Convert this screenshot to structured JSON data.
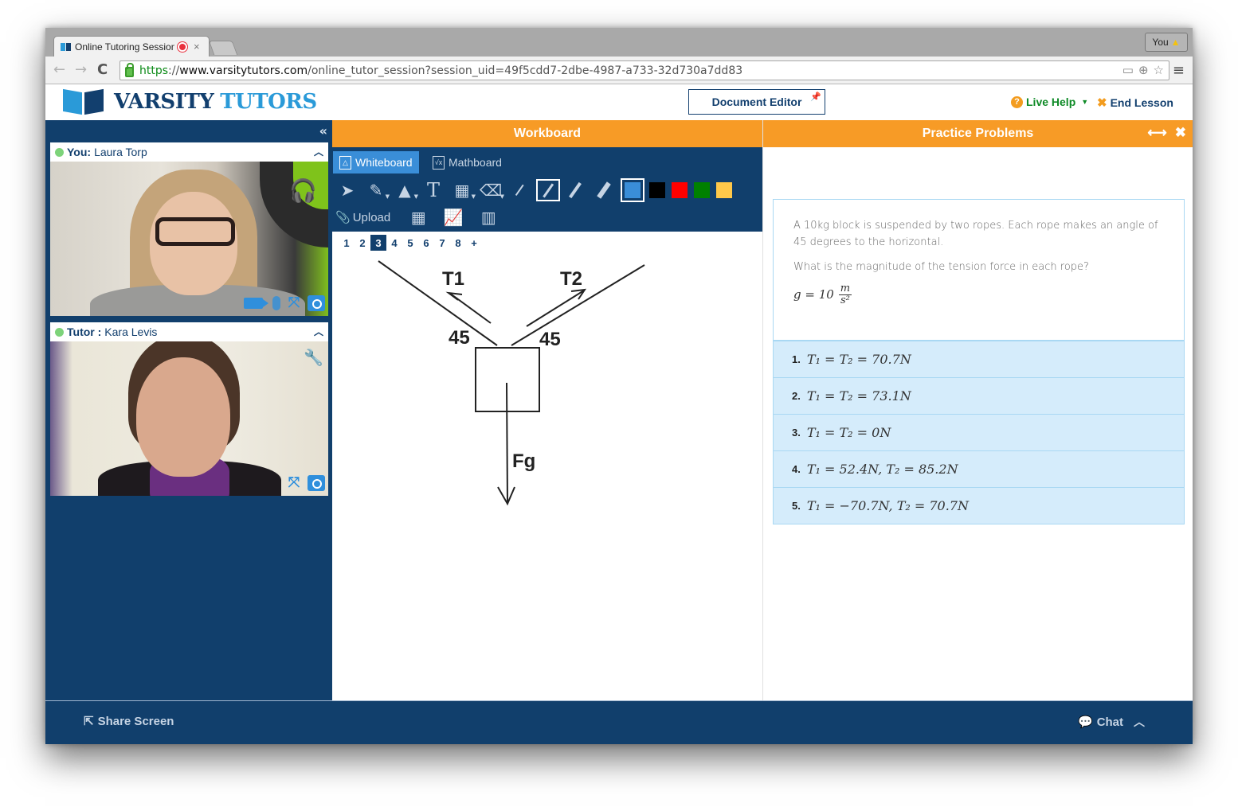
{
  "browser": {
    "tab_title": "Online Tutoring Session",
    "tab_close": "×",
    "profile_label": "You",
    "profile_warning_icon": "warning-icon",
    "url": {
      "scheme": "https",
      "separator": "://",
      "host": "www.varsitytutors.com",
      "path": "/online_tutor_session?session_uid=49f5cdd7-2dbe-4987-a733-32d730a7dd83"
    },
    "nav": {
      "back": "←",
      "forward": "→",
      "reload": "C"
    },
    "menu_icon": "≡"
  },
  "header": {
    "logo_word1": "VARSITY",
    "logo_word2": "TUTORS",
    "document_editor_label": "Document Editor",
    "live_help_label": "Live Help",
    "end_lesson_label": "End Lesson"
  },
  "sidebar": {
    "collapse_icon": "«",
    "participants": [
      {
        "role": "You:",
        "name": "Laura Torp",
        "status_color": "#7dd37a"
      },
      {
        "role": "Tutor :",
        "name": "Kara Levis",
        "status_color": "#7dd37a"
      }
    ]
  },
  "workboard": {
    "title": "Workboard",
    "tabs": [
      {
        "label": "Whiteboard",
        "active": true
      },
      {
        "label": "Mathboard",
        "active": false
      }
    ],
    "upload_label": "Upload",
    "text_tool": "T",
    "colors": [
      "#3a8ed8",
      "#000000",
      "#ff0000",
      "#008000",
      "#ffc84a"
    ],
    "selected_color": "#3a8ed8",
    "pages": [
      "1",
      "2",
      "3",
      "4",
      "5",
      "6",
      "7",
      "8",
      "+"
    ],
    "active_page": "3",
    "diagram": {
      "labels": {
        "t1": "T1",
        "t2": "T2",
        "angle_left": "45",
        "angle_right": "45",
        "fg": "Fg"
      }
    }
  },
  "practice": {
    "title": "Practice Problems",
    "question_p1": "A 10kg block is suspended by two ropes. Each rope makes an angle of 45 degrees to the horizontal.",
    "question_p2": "What is the magnitude of the tension force in each rope?",
    "given_lhs": "g = 10",
    "given_num": "m",
    "given_den": "s²",
    "answers": [
      {
        "n": "1.",
        "expr": "T₁ = T₂ = 70.7N"
      },
      {
        "n": "2.",
        "expr": "T₁ = T₂ = 73.1N"
      },
      {
        "n": "3.",
        "expr": "T₁ = T₂ = 0N"
      },
      {
        "n": "4.",
        "expr": "T₁ = 52.4N,  T₂ = 85.2N"
      },
      {
        "n": "5.",
        "expr": "T₁ = −70.7N,  T₂ = 70.7N"
      }
    ]
  },
  "footer": {
    "share_screen_label": "Share Screen",
    "chat_label": "Chat"
  }
}
